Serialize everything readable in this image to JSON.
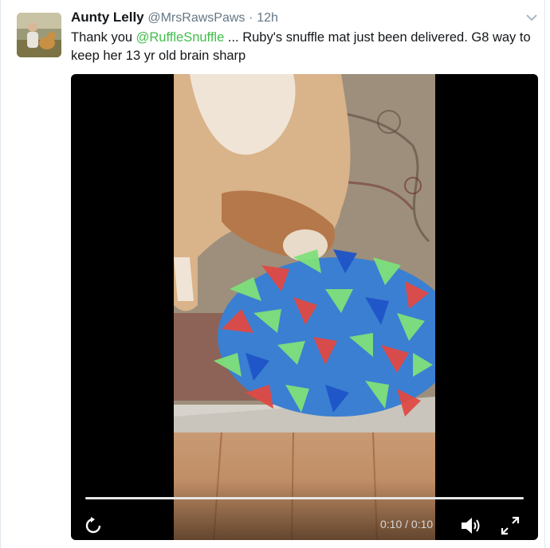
{
  "tweet": {
    "author_name": "Aunty Lelly",
    "author_handle": "@MrsRawsPaws",
    "separator": "·",
    "timestamp": "12h",
    "text_before": "Thank you ",
    "mention": "@RuffleSnuffle",
    "text_after": " ... Ruby's snuffle mat just been delivered. G8 way to keep her 13 yr old brain sharp"
  },
  "video": {
    "current_time": "0:10",
    "time_separator": " / ",
    "duration": "0:10",
    "progress": 1.0
  },
  "icons": {
    "avatar": "avatar",
    "caret": "chevron-down-icon",
    "replay": "replay-icon",
    "volume": "volume-icon",
    "fullscreen": "fullscreen-icon"
  },
  "colors": {
    "mention": "#41bd4b",
    "text": "#14171a",
    "muted": "#657786"
  }
}
